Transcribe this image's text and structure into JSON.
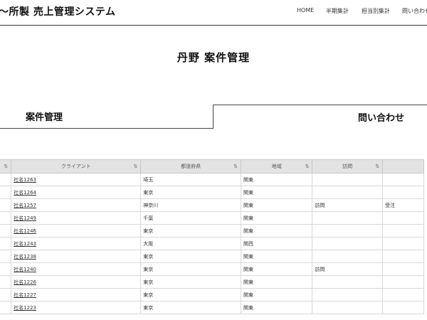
{
  "header": {
    "app_title": "〜所製 売上管理システム",
    "nav": [
      "HOME",
      "半期集計",
      "担当別集計",
      "問い合わせ"
    ]
  },
  "page_title": "丹野 案件管理",
  "tabs": {
    "case": "案件管理",
    "inquiry": "問い合わせ"
  },
  "table": {
    "columns": [
      "",
      "クライアント",
      "都道府県",
      "地域",
      "訪問",
      ""
    ],
    "sort_icon": "⇅",
    "rows": [
      {
        "client": "社名1263",
        "pref": "埼玉",
        "region": "関東",
        "visit": "",
        "status": ""
      },
      {
        "client": "社名1264",
        "pref": "東京",
        "region": "関東",
        "visit": "",
        "status": ""
      },
      {
        "client": "社名1257",
        "pref": "神奈川",
        "region": "関東",
        "visit": "訪問",
        "status": "受注"
      },
      {
        "client": "社名1249",
        "pref": "千葉",
        "region": "関東",
        "visit": "",
        "status": ""
      },
      {
        "client": "社名1246",
        "pref": "東京",
        "region": "関東",
        "visit": "",
        "status": ""
      },
      {
        "client": "社名1243",
        "pref": "大阪",
        "region": "関西",
        "visit": "",
        "status": ""
      },
      {
        "client": "社名1238",
        "pref": "東京",
        "region": "関東",
        "visit": "",
        "status": ""
      },
      {
        "client": "社名1240",
        "pref": "東京",
        "region": "関東",
        "visit": "訪問",
        "status": ""
      },
      {
        "client": "社名1226",
        "pref": "東京",
        "region": "関東",
        "visit": "",
        "status": ""
      },
      {
        "client": "社名1227",
        "pref": "東京",
        "region": "関東",
        "visit": "",
        "status": ""
      },
      {
        "client": "社名1223",
        "pref": "東京",
        "region": "関東",
        "visit": "",
        "status": ""
      }
    ]
  }
}
